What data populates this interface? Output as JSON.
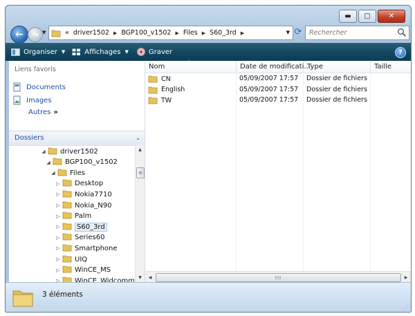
{
  "window": {
    "controls": {
      "minimize": "▬",
      "maximize": "▢",
      "close": "✕"
    }
  },
  "nav": {
    "back_icon": "back-arrow-icon",
    "forward_icon": "forward-arrow-icon"
  },
  "address": {
    "overflow": "«",
    "crumbs": [
      "driver1502",
      "BGP100_v1502",
      "Files",
      "S60_3rd"
    ]
  },
  "search": {
    "placeholder": "Rechercher"
  },
  "toolbar": {
    "organize": "Organiser",
    "views": "Affichages",
    "burn": "Graver",
    "help": "?"
  },
  "favorites": {
    "title": "Liens favoris",
    "items": [
      {
        "label": "Documents",
        "icon": "documents-icon"
      },
      {
        "label": "Images",
        "icon": "pictures-icon"
      }
    ],
    "more": "Autres",
    "more_glyph": "»"
  },
  "folders": {
    "title": "Dossiers",
    "tree": [
      {
        "label": "driver1502",
        "depth": 0,
        "expanded": true
      },
      {
        "label": "BGP100_v1502",
        "depth": 1,
        "expanded": true
      },
      {
        "label": "Files",
        "depth": 2,
        "expanded": true
      },
      {
        "label": "Desktop",
        "depth": 3,
        "expanded": false
      },
      {
        "label": "Nokia7710",
        "depth": 3,
        "expanded": false
      },
      {
        "label": "Nokia_N90",
        "depth": 3,
        "expanded": false
      },
      {
        "label": "Palm",
        "depth": 3,
        "expanded": false
      },
      {
        "label": "S60_3rd",
        "depth": 3,
        "expanded": false,
        "selected": true
      },
      {
        "label": "Series60",
        "depth": 3,
        "expanded": false
      },
      {
        "label": "Smartphone",
        "depth": 3,
        "expanded": false
      },
      {
        "label": "UIQ",
        "depth": 3,
        "expanded": false
      },
      {
        "label": "WinCE_MS",
        "depth": 3,
        "expanded": false
      },
      {
        "label": "WinCE_Widcomm",
        "depth": 3,
        "expanded": false
      }
    ]
  },
  "list": {
    "columns": {
      "name": "Nom",
      "date": "Date de modificati...",
      "type": "Type",
      "size": "Taille"
    },
    "rows": [
      {
        "name": "CN",
        "date": "05/09/2007 17:57",
        "type": "Dossier de fichiers",
        "size": ""
      },
      {
        "name": "English",
        "date": "05/09/2007 17:57",
        "type": "Dossier de fichiers",
        "size": ""
      },
      {
        "name": "TW",
        "date": "05/09/2007 17:57",
        "type": "Dossier de fichiers",
        "size": ""
      }
    ]
  },
  "status": {
    "count": "3 éléments"
  },
  "colors": {
    "toolbar": "#12465f",
    "link": "#1c4fa0",
    "folder": "#e8c35a",
    "close_button": "#c2432d"
  }
}
